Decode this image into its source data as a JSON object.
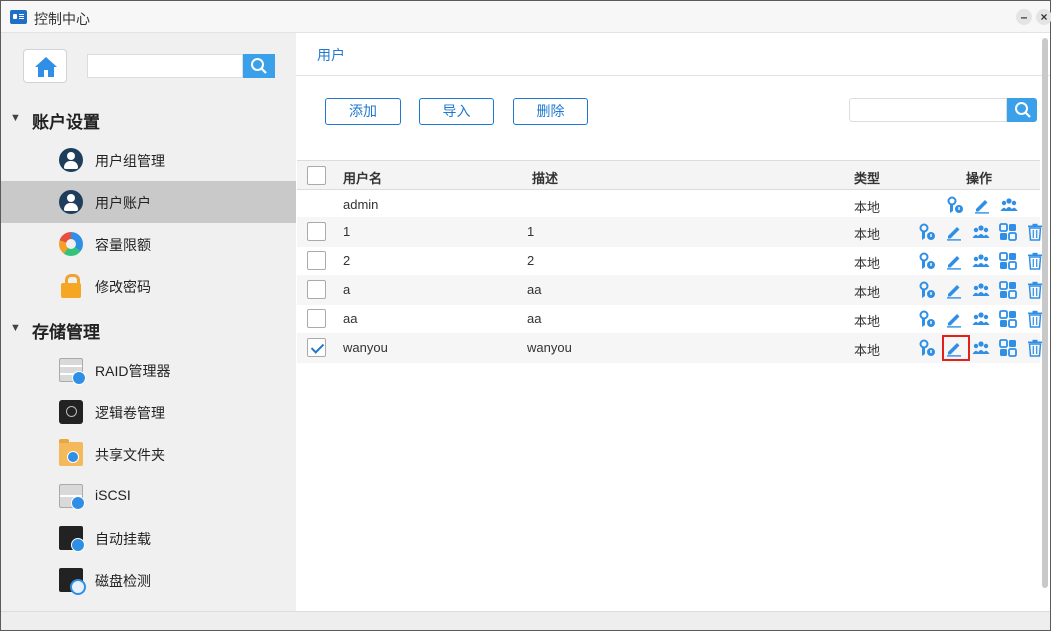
{
  "window": {
    "title": "控制中心",
    "minimize_label": "–",
    "close_label": "×"
  },
  "sidebar": {
    "search": {
      "placeholder": ""
    },
    "sections": [
      {
        "title": "账户设置",
        "items": [
          {
            "label": "用户组管理",
            "icon": "user-group-icon"
          },
          {
            "label": "用户账户",
            "icon": "user-account-icon",
            "active": true
          },
          {
            "label": "容量限额",
            "icon": "quota-pie-icon"
          },
          {
            "label": "修改密码",
            "icon": "lock-icon"
          }
        ]
      },
      {
        "title": "存储管理",
        "items": [
          {
            "label": "RAID管理器",
            "icon": "raid-icon"
          },
          {
            "label": "逻辑卷管理",
            "icon": "lvm-icon"
          },
          {
            "label": "共享文件夹",
            "icon": "share-folder-icon"
          },
          {
            "label": "iSCSI",
            "icon": "iscsi-icon"
          },
          {
            "label": "自动挂载",
            "icon": "auto-mount-icon"
          },
          {
            "label": "磁盘检测",
            "icon": "disk-check-icon"
          }
        ]
      }
    ]
  },
  "main": {
    "breadcrumb": "用户",
    "toolbar": {
      "add": "添加",
      "import": "导入",
      "delete": "删除",
      "search_placeholder": ""
    },
    "table": {
      "headers": {
        "username": "用户名",
        "description": "描述",
        "type": "类型",
        "actions": "操作"
      },
      "rows": [
        {
          "username": "admin",
          "description": "",
          "type": "本地",
          "checkbox": false,
          "checked": false
        },
        {
          "username": "1",
          "description": "1",
          "type": "本地",
          "checkbox": true,
          "checked": false
        },
        {
          "username": "2",
          "description": "2",
          "type": "本地",
          "checkbox": true,
          "checked": false
        },
        {
          "username": "a",
          "description": "aa",
          "type": "本地",
          "checkbox": true,
          "checked": false
        },
        {
          "username": "aa",
          "description": "aa",
          "type": "本地",
          "checkbox": true,
          "checked": false
        },
        {
          "username": "wanyou",
          "description": "wanyou",
          "type": "本地",
          "checkbox": true,
          "checked": true,
          "edit_highlighted": true
        }
      ]
    }
  },
  "colors": {
    "accent": "#1f78d1",
    "search_button": "#3ba0ea",
    "highlight": "#e0211c",
    "active_nav": "#c9c9c9"
  }
}
